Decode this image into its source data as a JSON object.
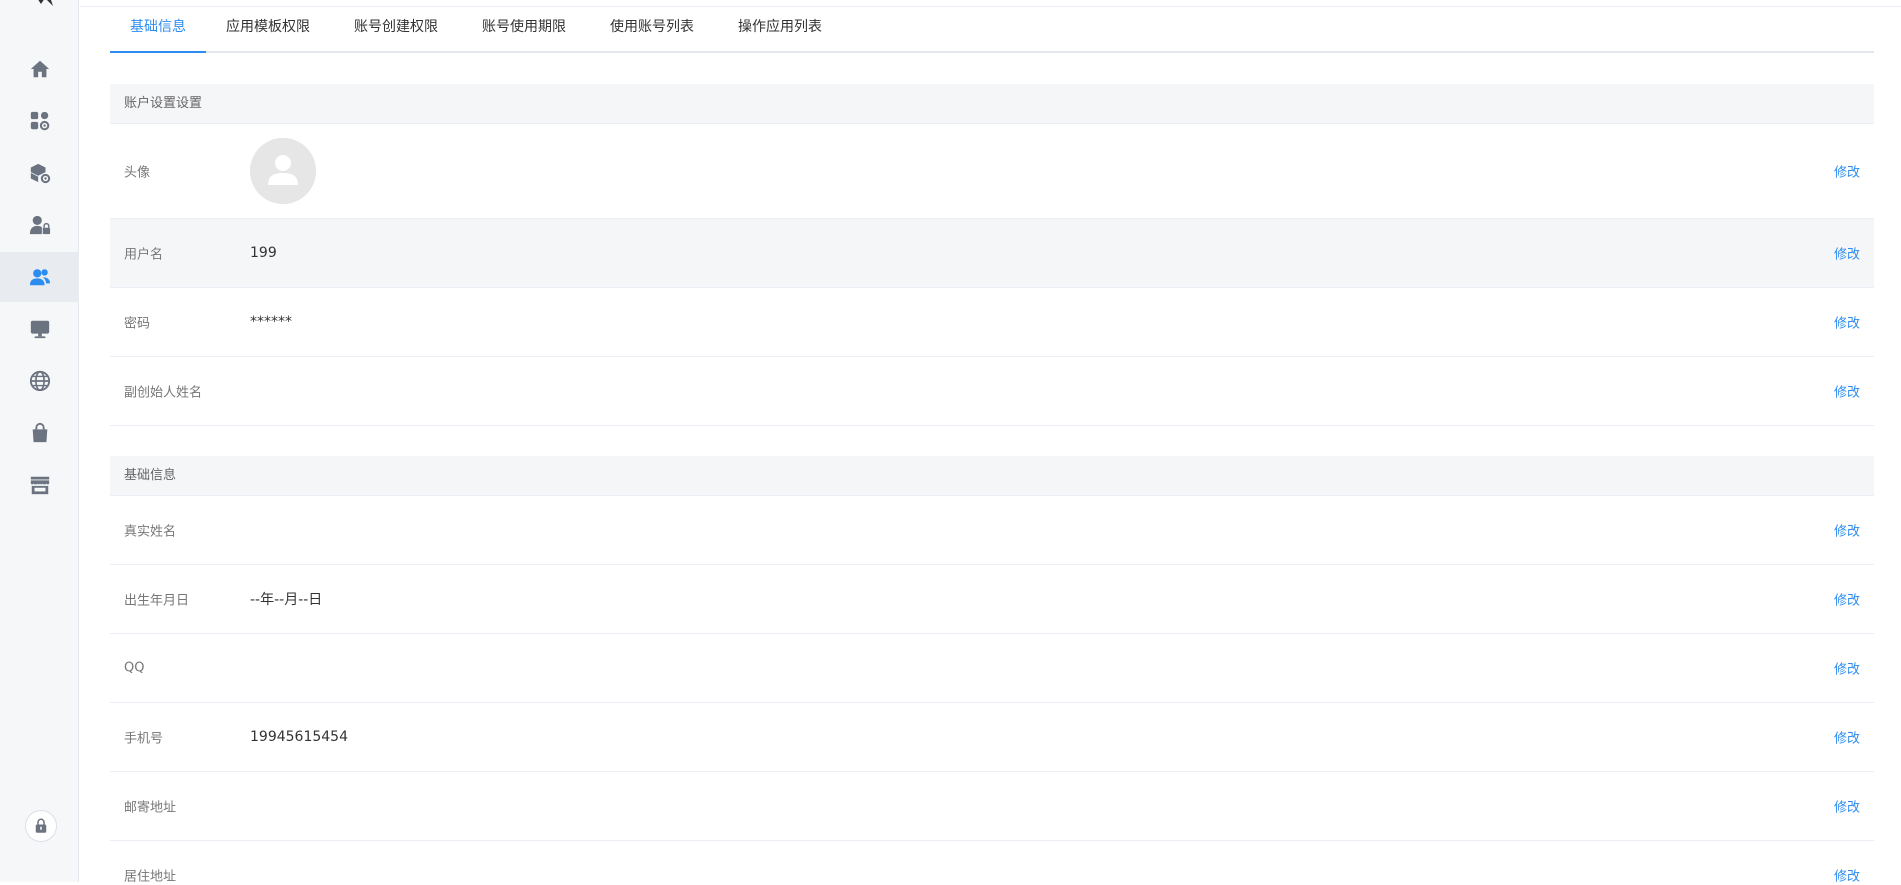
{
  "colors": {
    "accent": "#2d8cf0",
    "sidebar_bg": "#f5f7f9",
    "sidebar_icon": "#6b7280"
  },
  "sidebar": {
    "items": [
      {
        "icon": "home-icon",
        "active": false
      },
      {
        "icon": "apps-settings-icon",
        "active": false
      },
      {
        "icon": "package-settings-icon",
        "active": false
      },
      {
        "icon": "user-lock-icon",
        "active": false
      },
      {
        "icon": "users-icon",
        "active": true
      },
      {
        "icon": "monitor-icon",
        "active": false
      },
      {
        "icon": "globe-icon",
        "active": false
      },
      {
        "icon": "shopping-bag-icon",
        "active": false
      },
      {
        "icon": "store-icon",
        "active": false
      }
    ],
    "lock_icon": "lock-icon"
  },
  "tabs": [
    {
      "label": "基础信息",
      "active": true
    },
    {
      "label": "应用模板权限",
      "active": false
    },
    {
      "label": "账号创建权限",
      "active": false
    },
    {
      "label": "账号使用期限",
      "active": false
    },
    {
      "label": "使用账号列表",
      "active": false
    },
    {
      "label": "操作应用列表",
      "active": false
    }
  ],
  "account_section": {
    "title": "账户设置设置",
    "rows": [
      {
        "label": "头像",
        "value": "",
        "edit": "修改"
      },
      {
        "label": "用户名",
        "value": "199",
        "edit": "修改"
      },
      {
        "label": "密码",
        "value": "******",
        "edit": "修改"
      },
      {
        "label": "副创始人姓名",
        "value": "",
        "edit": "修改"
      }
    ]
  },
  "basic_section": {
    "title": "基础信息",
    "rows": [
      {
        "label": "真实姓名",
        "value": "",
        "edit": "修改"
      },
      {
        "label": "出生年月日",
        "value": "--年--月--日",
        "edit": "修改"
      },
      {
        "label": "QQ",
        "value": "",
        "edit": "修改"
      },
      {
        "label": "手机号",
        "value": "19945615454",
        "edit": "修改"
      },
      {
        "label": "邮寄地址",
        "value": "",
        "edit": "修改"
      },
      {
        "label": "居住地址",
        "value": "",
        "edit": "修改"
      }
    ]
  }
}
